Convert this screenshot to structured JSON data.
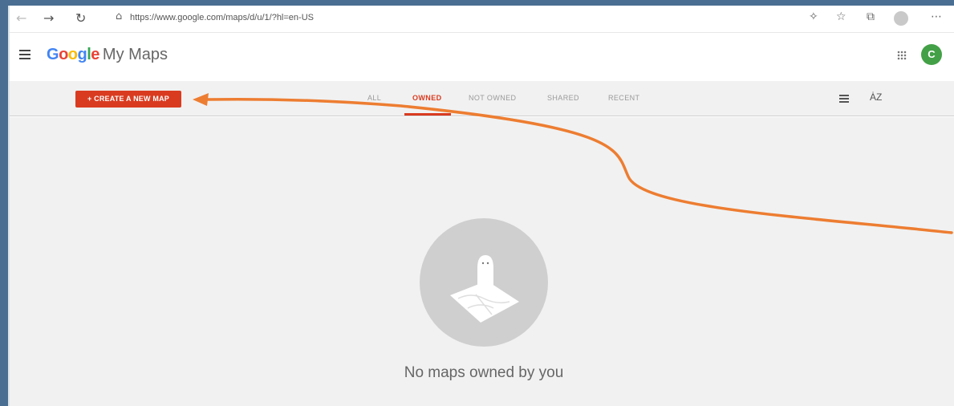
{
  "browser": {
    "url": "https://www.google.com/maps/d/u/1/?hl=en-US",
    "back_icon": "←",
    "forward_icon": "→",
    "reload_icon": "↻",
    "lock_icon": "⚿",
    "more_icon": "⋯"
  },
  "header": {
    "brand_google": [
      "G",
      "o",
      "o",
      "g",
      "l",
      "e"
    ],
    "product_name": "My Maps",
    "account_initial": "C"
  },
  "toolbar": {
    "create_label": "+ CREATE A NEW MAP",
    "tabs": [
      {
        "label": "ALL",
        "active": false
      },
      {
        "label": "OWNED",
        "active": true
      },
      {
        "label": "NOT OWNED",
        "active": false
      },
      {
        "label": "SHARED",
        "active": false
      },
      {
        "label": "RECENT",
        "active": false
      }
    ],
    "sort_label": "ȦZ"
  },
  "empty_state": {
    "message": "No maps owned by you"
  },
  "colors": {
    "accent": "#d93b20",
    "annotation_arrow": "#ed7d31",
    "frame": "#4a6e91"
  }
}
